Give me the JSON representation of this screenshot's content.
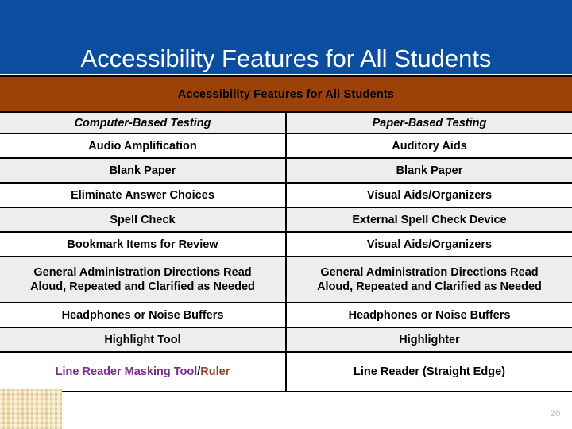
{
  "slide": {
    "title": "Accessibility Features for All Students",
    "page_number": "20",
    "colors": {
      "banner_blue": "#0B4D9E",
      "table_banner_brown": "#9C4208",
      "column_header_teal": "#1E93AE",
      "highlight_purple": "#7B2D8E",
      "highlight_maroon": "#8C4A2E",
      "row_shaded": "#EFEDEB",
      "row_plain": "#FFFFFF",
      "corner_swatch_beige": "#F0DFB2",
      "page_number_gray": "#BFBFB3"
    }
  },
  "table": {
    "banner": "Accessibility Features for All Students",
    "headers": {
      "computer": "Computer-Based Testing",
      "paper": "Paper-Based Testing"
    },
    "rows": [
      {
        "computer": "Audio Amplification",
        "paper": "Auditory Aids"
      },
      {
        "computer": "Blank Paper",
        "paper": "Blank Paper"
      },
      {
        "computer": "Eliminate Answer Choices",
        "paper": "Visual Aids/Organizers"
      },
      {
        "computer": "Spell Check",
        "paper": "External Spell Check Device"
      },
      {
        "computer": "Bookmark Items for Review",
        "paper": "Visual Aids/Organizers"
      },
      {
        "computer_line1": "General Administration Directions Read",
        "computer_line2": "Aloud, Repeated  and Clarified as Needed",
        "paper_line1": "General Administration Directions Read",
        "paper_line2": "Aloud, Repeated  and Clarified as Needed"
      },
      {
        "computer": "Headphones or Noise Buffers",
        "paper": "Headphones or Noise Buffers"
      },
      {
        "computer": "Highlight Tool",
        "paper": "Highlighter"
      },
      {
        "computer_part1": "Line Reader Masking Tool",
        "computer_sep": "/",
        "computer_part2": "Ruler",
        "paper": "Line Reader (Straight Edge)"
      }
    ]
  }
}
